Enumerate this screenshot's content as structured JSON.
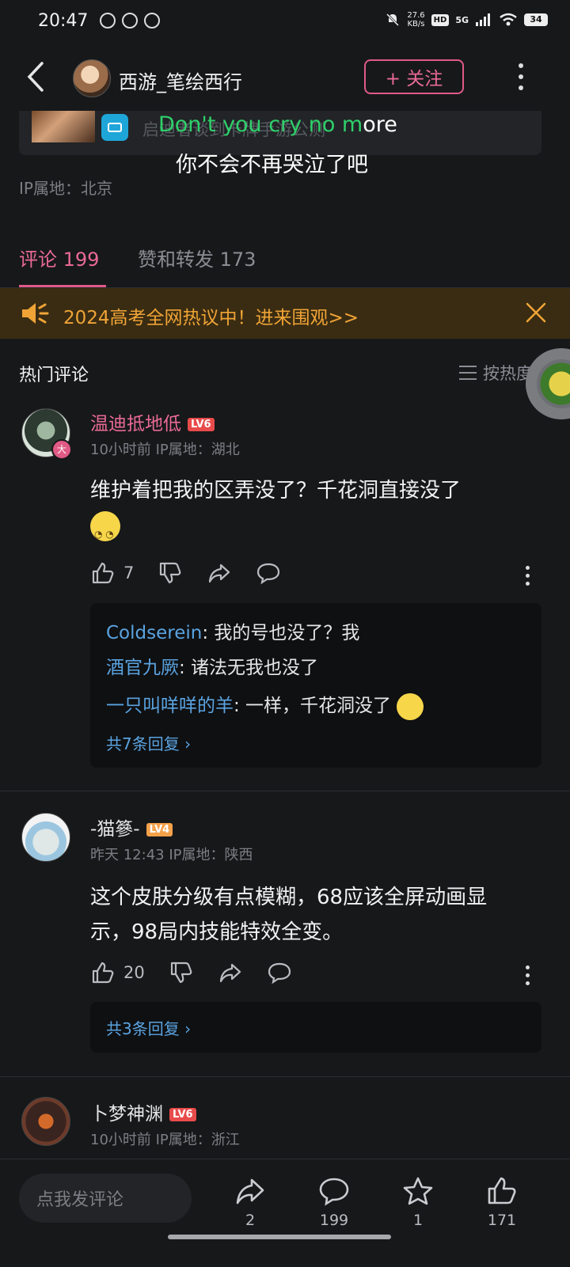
{
  "status_bar": {
    "time": "20:47",
    "speed_value": "27.6",
    "speed_unit": "KB/s",
    "hd": "HD",
    "network": "5G",
    "battery": "34"
  },
  "header": {
    "user_name": "西游_笔绘西行",
    "follow_label": "+ 关注"
  },
  "shared_card": {
    "text": "启迪者谈到卡牌手游公测"
  },
  "lyrics": {
    "line1_sung": "Don't you cry no m",
    "line1_rest": "ore",
    "line2": "你不会不再哭泣了吧"
  },
  "post": {
    "ip": "IP属地：北京"
  },
  "tabs": {
    "comments": "评论 199",
    "likes_forwards": "赞和转发 173"
  },
  "banner": {
    "text": "2024高考全网热议中！进来围观>>",
    "accent_color": "#f0a436"
  },
  "section": {
    "title": "热门评论",
    "sort_label": "按热度"
  },
  "comments": [
    {
      "name": "温迪抵地低",
      "name_color": "#e96a94",
      "level": "LV6",
      "avatar_badge": "大",
      "meta": "10小时前  IP属地：湖北",
      "body_line1": "维护着把我的区弄没了？千花洞直接没了",
      "likes": "7",
      "replies": [
        {
          "user": "Coldserein",
          "text": ": 我的号也没了？我"
        },
        {
          "user": "酒官九厥",
          "text": ": 诸法无我也没了"
        },
        {
          "user": "一只叫咩咩的羊",
          "text": ": 一样，千花洞没了"
        }
      ],
      "more_replies": "共7条回复 ›"
    },
    {
      "name": "-猫篸-",
      "name_color": "#e6e6e6",
      "level": "LV4",
      "meta": "昨天 12:43  IP属地：陕西",
      "body_line1": "这个皮肤分级有点模糊，68应该全屏动画显",
      "body_line2": "示，98局内技能特效全变。",
      "likes": "20",
      "more_replies": "共3条回复 ›"
    },
    {
      "name": "卜梦神渊",
      "name_color": "#e6e6e6",
      "level": "LV6",
      "meta": "10小时前  IP属地：浙江"
    }
  ],
  "bottom_bar": {
    "input_placeholder": "点我发评论",
    "forward_count": "2",
    "comment_count": "199",
    "star_count": "1",
    "like_count": "171"
  }
}
